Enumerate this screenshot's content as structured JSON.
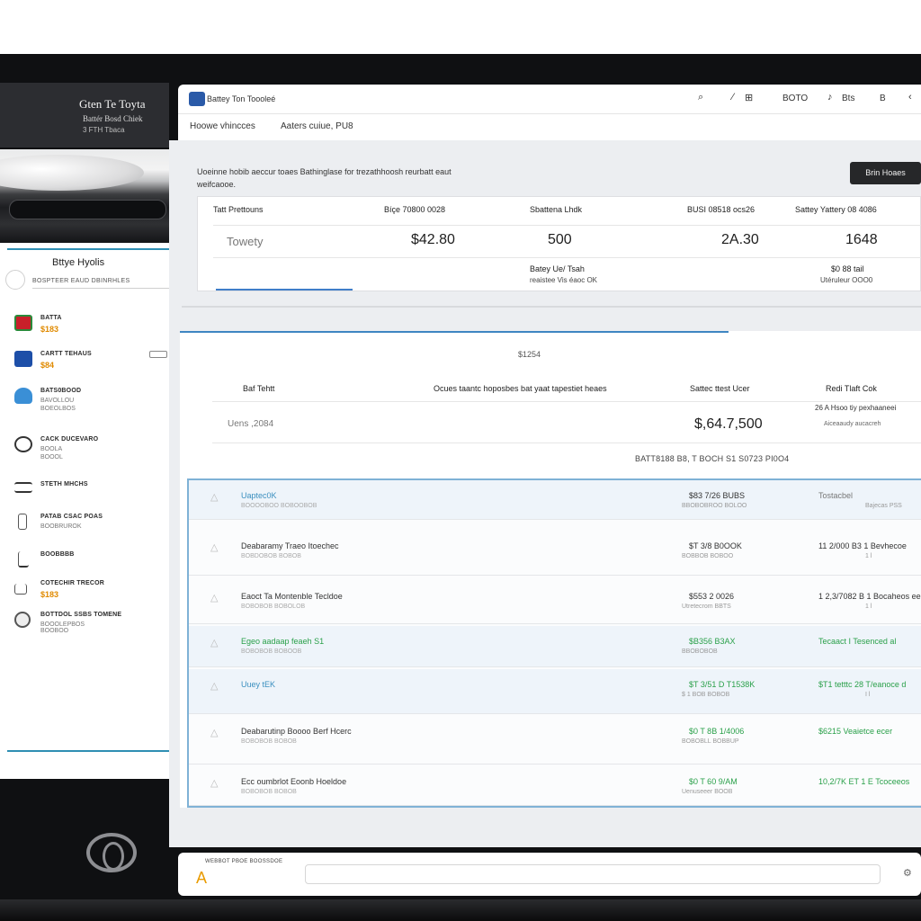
{
  "brand": {
    "title": "Gten Te Toyta",
    "sub1": "Battér Bosd Chiek",
    "sub2": "3 FTH Tbaca"
  },
  "sidebar": {
    "heading": "Bttye Hyolis",
    "subheading": "BOSPTEER EAUD DBINRHLES",
    "items": [
      {
        "label": "BATTA",
        "value": "$183"
      },
      {
        "label": "CARTT TEHAUS",
        "value": "$84"
      },
      {
        "label": "BATS0BOOD",
        "value": "BAVOLLOU",
        "value2": "BOEOLBOS"
      },
      {
        "label": "CACK DUCEVARO",
        "value": "BOOLA",
        "value2": "BOOOL"
      },
      {
        "label": "STETH MHCHS",
        "value": ""
      },
      {
        "label": "PATAB CSAC POAS",
        "value": "BOOBRUROK"
      },
      {
        "label": "BOOBBBB",
        "value": ""
      },
      {
        "label": "COTECHIR TRECOR",
        "value": "$183"
      },
      {
        "label": "BOTTDOL SSBS TOMENE",
        "value": "BOOOLEPBOS",
        "value2": "BOOBOO"
      }
    ]
  },
  "topbar": {
    "app_title": "Battey Ton Toooleé",
    "items": [
      "BOTO",
      "Bts",
      "B"
    ]
  },
  "nav": {
    "items": [
      "Hoowe vhincces",
      "Aaters cuiue, PU8"
    ]
  },
  "description": "Uoeinne hobib aeccur toaes Bathinglase for trezathhoosh reurbatt eaut weifcaooe.",
  "header_button": "Brin Hoaes",
  "summary": {
    "headers": [
      "Tatt Prettouns",
      "Bíçe 70800 0028",
      "Sbattena Lhdk",
      "BUSI 08518 ocs26",
      "Sattey Yattery 08 4086"
    ],
    "row_label": "Towety",
    "values": [
      "$42.80",
      "500",
      "2A.30",
      "1648"
    ],
    "foot_left_1": "Batey Ue/ Tsah",
    "foot_left_2": "reaistee Vis éaoc OK",
    "foot_right_1": "$0 88 tail",
    "foot_right_2": "Utéruleur OOO0"
  },
  "results": {
    "count": "$1254",
    "headers": [
      "Baf Tehtt",
      "Ocues taantc hoposbes bat yaat tapestiet heaes",
      "Sattec ttest Ucer",
      "Redi Tlaft Cok"
    ],
    "row_label": "Uens ,2084",
    "total": "$,64.7,500",
    "note1": "26 A Hsoo tiy pexhaaneei",
    "note2": "Aiceaaudy aucacreh",
    "code": "BATT8188 B8, T BOCH S1 S0723 PI0O4"
  },
  "list": [
    {
      "title": "Uaptec0K",
      "sub": "BOOOOBOO BOBOOBOB",
      "price": "$83 7/26 BUBS",
      "price_sub": "BBOBOBROO BOLOO",
      "right": "Tostacbel",
      "right_sub": "Bajecas PSS",
      "accent": "#3a8fbf",
      "price_color": "#333",
      "right_color": "#777",
      "hl": true
    },
    {
      "title": "Deabaramy Traeo Itoechec",
      "sub": "BOBDOBOB BOBOB",
      "price": "$T 3/8 B0OOK",
      "price_sub": "BOBBOB BOBOO",
      "right": "11 2/000 B3 1 Bevhecoe",
      "right_sub": "1 l",
      "accent": "#333",
      "price_color": "#333",
      "right_color": "#333",
      "hl": false
    },
    {
      "title": "Eaoct Ta Montenble Tecldoe",
      "sub": "BOBOBOB BOBOLOB",
      "price": "$553 2 0026",
      "price_sub": "Utretecrom BBTS",
      "right": "1 2,3/7082 B 1 Bocaheos ee",
      "right_sub": "1 l",
      "accent": "#333",
      "price_color": "#333",
      "right_color": "#333",
      "hl": false
    },
    {
      "title": "Egeo aadaap feaeh S1",
      "sub": "BOBOBOB BOBOOB",
      "price": "$B356 B3AX",
      "price_sub": "BBOBOBOB",
      "right": "Tecaact I Tesenced al",
      "right_sub": "",
      "accent": "#2aa04a",
      "price_color": "#2aa04a",
      "right_color": "#2aa04a",
      "hl": true
    },
    {
      "title": "Uuey tEK",
      "sub": "",
      "price": "$T 3/51 D T1538K",
      "price_sub": "$ 1 BOB BOBOB",
      "right": "$T1 tetttc 28 T/eanoce d",
      "right_sub": "I l",
      "accent": "#3a8fbf",
      "price_color": "#2aa04a",
      "right_color": "#2aa04a",
      "hl": true
    },
    {
      "title": "Deabarutinp Boooo Berf Hcerc",
      "sub": "BOBOBOB BOBOB",
      "price": "$0 T 8B 1/4006",
      "price_sub": "BOBOBLL BOBBUP",
      "right": "$6215 Veaietce ecer",
      "right_sub": "",
      "accent": "#333",
      "price_color": "#2aa04a",
      "right_color": "#2aa04a",
      "hl": false
    },
    {
      "title": "Ecc oumbrlot Eoonb Hoeldoe",
      "sub": "BOBOBOB BOBOB",
      "price": "$0 T 60 9/AM",
      "price_sub": "Uenuseeer BOOB",
      "right": "10,2/7K ET 1 E Tcoceeos",
      "right_sub": "",
      "accent": "#333",
      "price_color": "#2aa04a",
      "right_color": "#2aa04a",
      "hl": false
    }
  ],
  "bottombar": {
    "caption": "WEBBOT PBOE BOOSSDOE",
    "logo": "A"
  }
}
